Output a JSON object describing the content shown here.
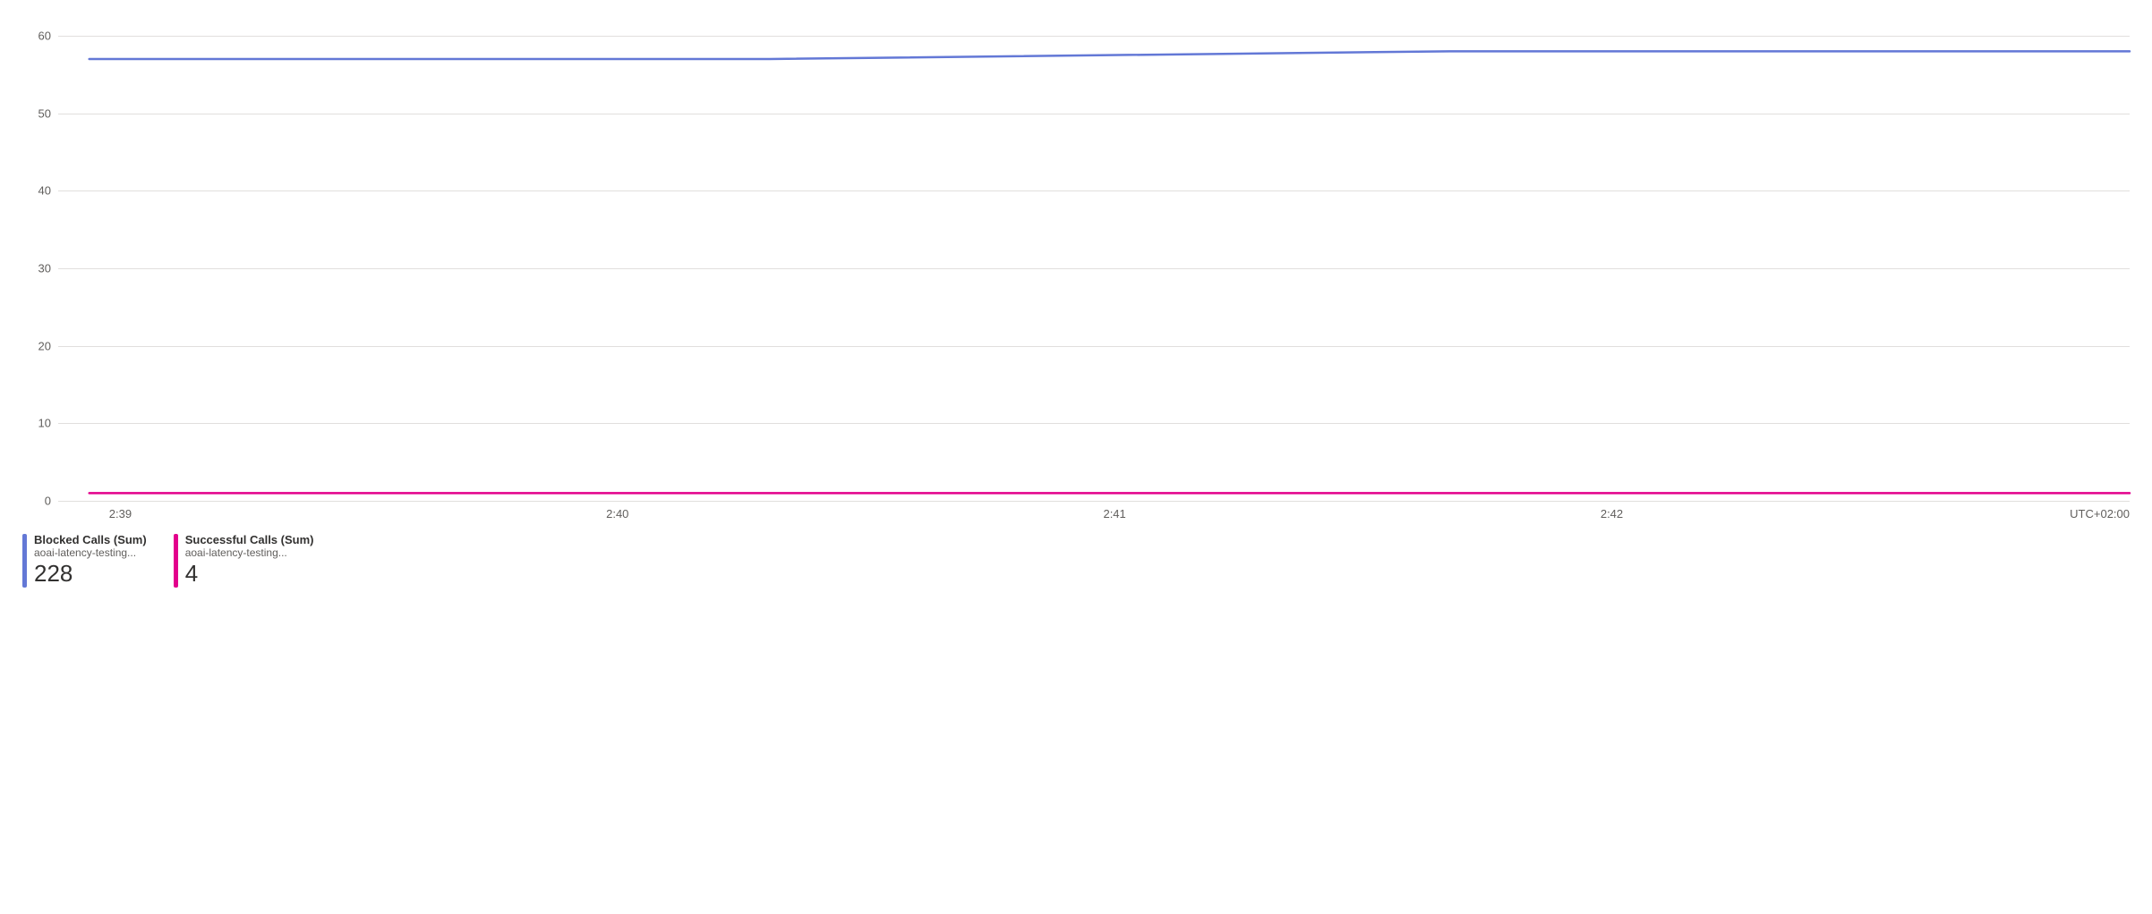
{
  "chart_data": {
    "type": "line",
    "x": [
      "2:39",
      "2:40",
      "2:41",
      "2:42"
    ],
    "series": [
      {
        "name": "Blocked Calls (Sum)",
        "values": [
          57,
          57,
          58,
          58
        ],
        "color": "#6378d6"
      },
      {
        "name": "Successful Calls (Sum)",
        "values": [
          1,
          1,
          1,
          1
        ],
        "color": "#e3008c"
      }
    ],
    "ylim": [
      0,
      60
    ],
    "y_ticks": [
      0,
      10,
      20,
      30,
      40,
      50,
      60
    ],
    "xlabel": "",
    "ylabel": "",
    "title": ""
  },
  "x_axis": {
    "ticks": [
      "2:39",
      "2:40",
      "2:41",
      "2:42"
    ],
    "tz": "UTC+02:00"
  },
  "legend": {
    "items": [
      {
        "metric": "Blocked Calls (Sum)",
        "resource": "aoai-latency-testing...",
        "value": "228",
        "color": "#6378d6"
      },
      {
        "metric": "Successful Calls (Sum)",
        "resource": "aoai-latency-testing...",
        "value": "4",
        "color": "#e3008c"
      }
    ]
  },
  "colors": {
    "grid": "#e1dfdd",
    "text_muted": "#605e5c"
  }
}
